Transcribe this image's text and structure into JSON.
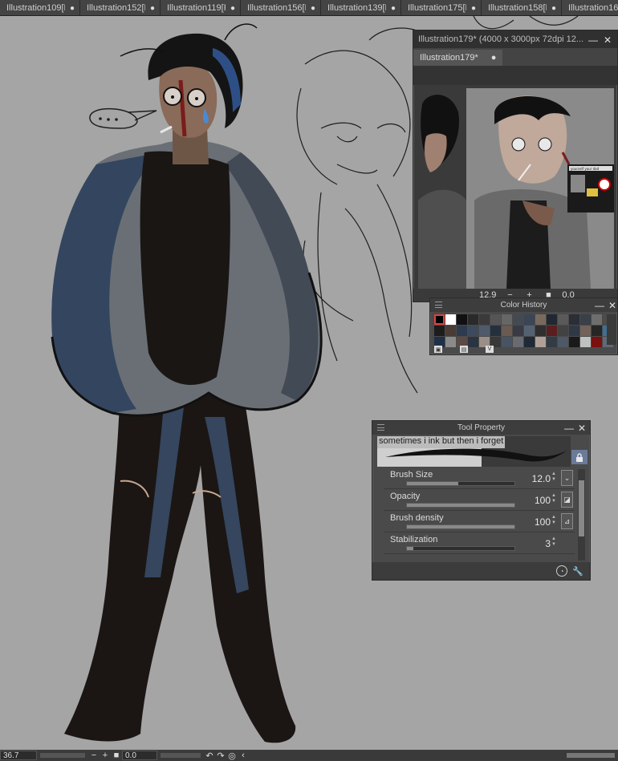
{
  "tabs": [
    {
      "label": "Illustration109[R"
    },
    {
      "label": "Illustration152[R"
    },
    {
      "label": "Illustration119[R"
    },
    {
      "label": "Illustration156[R"
    },
    {
      "label": "Illustration139[R"
    },
    {
      "label": "Illustration175[R"
    },
    {
      "label": "Illustration158[R"
    },
    {
      "label": "Illustration16("
    }
  ],
  "navigator": {
    "title": "Illustration179* (4000 x 3000px 72dpi 12...",
    "tab_label": "Illustration179*",
    "zoom": "12.9",
    "rotation": "0.0",
    "thumbnail_text": "yourself your dad"
  },
  "color_history": {
    "title": "Color History",
    "swatches": [
      "#000000",
      "#ffffff",
      "#111111",
      "#2a2a2a",
      "#3a3a3a",
      "#555555",
      "#666666",
      "#444a52",
      "#3b4556",
      "#7a6a5e",
      "#222831",
      "#5a5a5a",
      "#2b2e35",
      "#3a3f48",
      "#6e6e6e",
      "#4b4b4b",
      "#1c1c1c",
      "#4a3b35",
      "#2e3b4e",
      "#3d4a5d",
      "#4f5b6b",
      "#25303f",
      "#6b5a52",
      "#3a3a44",
      "#556070",
      "#2f2f2f",
      "#5a1e1e",
      "#424242",
      "#303846",
      "#73625a",
      "#262626",
      "#3f6f95",
      "#1f2f46",
      "#8a8a8a",
      "#5c4a44",
      "#2a3442",
      "#9a8f88",
      "#383838",
      "#485464",
      "#6a6a72",
      "#202a36",
      "#b0a098",
      "#333b46",
      "#4e5866",
      "#1a1a1a",
      "#c0c0c0",
      "#7a1010",
      "#5e6a78"
    ]
  },
  "tool_property": {
    "title": "Tool Property",
    "brush_name": "sometimes i ink but then i forget",
    "rows": [
      {
        "label": "Brush Size",
        "value": "12.0",
        "fill": 0.48
      },
      {
        "label": "Opacity",
        "value": "100",
        "fill": 1.0
      },
      {
        "label": "Brush density",
        "value": "100",
        "fill": 1.0
      },
      {
        "label": "Stabilization",
        "value": "3",
        "fill": 0.06
      }
    ]
  },
  "status": {
    "zoom": "36.7",
    "rotation": "0.0"
  },
  "icons": {
    "close": "close-icon",
    "minimize": "minimize-icon",
    "lock": "lock-icon",
    "menu": "menu-icon"
  }
}
